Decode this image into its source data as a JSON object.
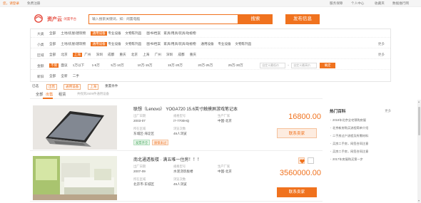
{
  "topbar": {
    "greeting": "您，请登录",
    "register": "免费注册",
    "service": "服务保障",
    "personal_center": "个人中心",
    "favorites": "收藏夹",
    "mobile": "数据维行网"
  },
  "logo": {
    "name": "资产云",
    "subtitle": "·闲置平台"
  },
  "search": {
    "placeholder": "输入搜索关键词，如：闲置电脑",
    "button_label": "搜索"
  },
  "post_label": "发布信息",
  "filters": [
    {
      "label": "大类",
      "options": [
        "全部",
        "土地/房屋/建筑物",
        "通用设备",
        "专业设备",
        "文物陈列品",
        "图书/档案",
        "家具/用具/装具/动植物"
      ],
      "selected": 2
    },
    {
      "label": "小类",
      "options": [
        "全部",
        "土地/房屋/建筑物",
        "通用设备",
        "专业设备",
        "文物陈列品",
        "图书/档案",
        "家具/用具/装具/动植物",
        "通用设备",
        "专业设备",
        "文物陈列品"
      ],
      "selected": 2,
      "more": "更多"
    },
    {
      "label": "区域",
      "options": [
        "全部",
        "北京",
        "上海",
        "广州",
        "深圳",
        "成都",
        "重庆",
        "北京",
        "上海",
        "广州",
        "深圳",
        "成都",
        "重庆"
      ],
      "selected": 2,
      "more": "更多"
    },
    {
      "label": "金额",
      "options": [
        "不限",
        "面议",
        "1万以下",
        "1-5万",
        "5万-10万",
        "10万-15万",
        "15万-20万",
        "20万-25万",
        "25万-30万"
      ],
      "selected": 0,
      "price_min_placeholder": "自定义最低价",
      "price_max_placeholder": "自定义最高价",
      "confirm_label": "确定"
    },
    {
      "label": "新旧",
      "options": [
        "全部",
        "全新",
        "二手"
      ],
      "selected": -1
    }
  ],
  "selection": {
    "label": "已选",
    "tags": [
      "出售",
      "通用设备",
      "上海"
    ],
    "clear": "重置条件"
  },
  "tabs": {
    "items": [
      "全部",
      "出售",
      "租赁"
    ],
    "selected": 1,
    "count_text": "共找到2609件通用设备"
  },
  "listings": [
    {
      "title": "联想（Lenovo） YOGA720 15.6英寸触摸屏游戏笔记本",
      "fields": [
        {
          "k": "出厂日期",
          "v": "2003-07"
        },
        {
          "k": "规格型号",
          "v": "i7-7700HQ"
        },
        {
          "k": "生产厂家",
          "v": "中国-北京"
        },
        {
          "k": "所在区域",
          "v": "东城区-海淀区"
        },
        {
          "k": "浏览次数",
          "v": "49人浏览"
        }
      ],
      "badges": [
        "发票齐全",
        "质保未过"
      ],
      "price": "16800.00",
      "contact_label": "联系卖家"
    },
    {
      "title": "南北通透板楼 · 满五唯一住房！！！",
      "fields": [
        {
          "k": "出厂日期",
          "v": "2007-09"
        },
        {
          "k": "规格型号",
          "v": "水泥浇筑板楼"
        },
        {
          "k": "生产厂家",
          "v": "中国-北京"
        },
        {
          "k": "所在区域",
          "v": "北京市-东城区"
        },
        {
          "k": "浏览次数",
          "v": "49人浏览"
        }
      ],
      "badges": [],
      "price": "3560000.00",
      "contact_label": "联系卖家"
    }
  ],
  "hot": {
    "title": "热门百科",
    "more": "更多",
    "items": [
      "2018年北京全宅预购房屋",
      "北京新房购买流程简单介绍",
      "二手房过户流程及所需材料",
      "买房二手房，网签合同注意",
      "买房二手房，网签合同注意",
      "2017年房屋购买第一步"
    ]
  },
  "colors": {
    "accent": "#f0721e",
    "brand_red": "#e5483b",
    "badge_green": "#4aa860"
  }
}
